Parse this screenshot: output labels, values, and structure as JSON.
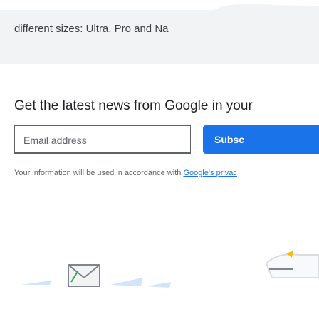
{
  "intro": {
    "text": "different sizes: Ultra, Pro and Na"
  },
  "newsletter": {
    "title": "Get the latest news from Google in your",
    "email_placeholder": "Email address",
    "subscribe_label": "Subsc",
    "privacy_prefix": "Your information will be used in accordance with ",
    "privacy_link": "Google's privac"
  },
  "colors": {
    "accent": "#1a73e8",
    "card_background": "#f1f3f4",
    "text": "#3c4043"
  },
  "icons": [
    "email-envelope-icon"
  ]
}
